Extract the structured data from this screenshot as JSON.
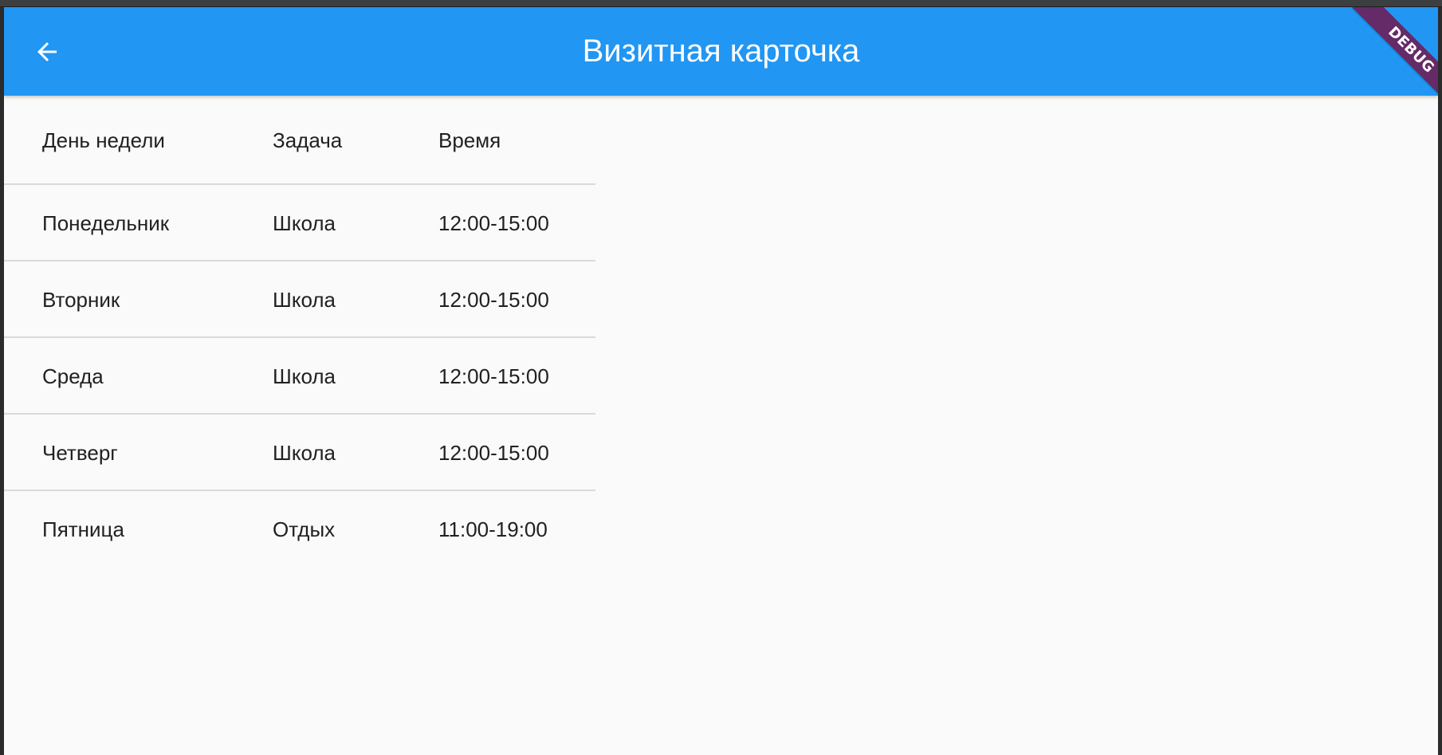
{
  "app_bar": {
    "title": "Визитная карточка",
    "back_icon": "arrow-back-icon",
    "color": "#2196f3"
  },
  "debug_banner": {
    "label": "DEBUG"
  },
  "table": {
    "columns": [
      "День недели",
      "Задача",
      "Время"
    ],
    "rows": [
      [
        "Понедельник",
        "Школа",
        "12:00-15:00"
      ],
      [
        "Вторник",
        "Школа",
        "12:00-15:00"
      ],
      [
        "Среда",
        "Школа",
        "12:00-15:00"
      ],
      [
        "Четверг",
        "Школа",
        "12:00-15:00"
      ],
      [
        "Пятница",
        "Отдых",
        "11:00-19:00"
      ]
    ]
  }
}
